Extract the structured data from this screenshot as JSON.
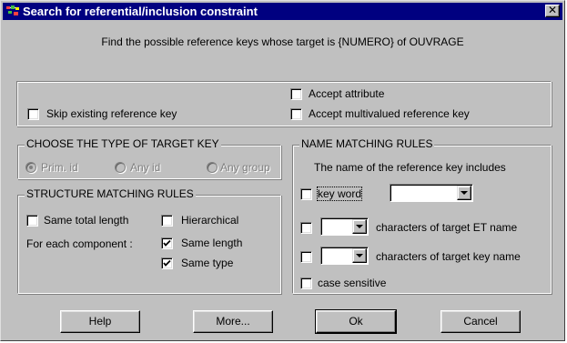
{
  "window": {
    "title": "Search for referential/inclusion constraint",
    "close_glyph": "✕"
  },
  "header": {
    "description": "Find the possible reference keys whose target is {NUMERO} of OUVRAGE"
  },
  "options": {
    "skip_existing": {
      "label": "Skip existing reference key",
      "checked": false
    },
    "accept_attribute": {
      "label": "Accept attribute",
      "checked": false
    },
    "accept_multivalued": {
      "label": "Accept multivalued reference key",
      "checked": false
    }
  },
  "target_key": {
    "title": "CHOOSE THE TYPE OF TARGET KEY",
    "options": [
      {
        "label": "Prim. id",
        "selected": true,
        "enabled": false
      },
      {
        "label": "Any id",
        "selected": false,
        "enabled": false
      },
      {
        "label": "Any group",
        "selected": false,
        "enabled": false
      }
    ]
  },
  "structure": {
    "title": "STRUCTURE MATCHING RULES",
    "same_total_length": {
      "label": "Same total length",
      "checked": false
    },
    "hierarchical": {
      "label": "Hierarchical",
      "checked": false
    },
    "for_each_component": "For each component :",
    "same_length": {
      "label": "Same length",
      "checked": true
    },
    "same_type": {
      "label": "Same type",
      "checked": true
    }
  },
  "name_matching": {
    "title": "NAME MATCHING RULES",
    "subtitle": "The name of the reference key includes",
    "key_word": {
      "label": "key word",
      "checked": false,
      "value": ""
    },
    "target_et": {
      "label": "characters of target ET name",
      "checked": false,
      "value": ""
    },
    "target_key_name": {
      "label": "characters of target key name",
      "checked": false,
      "value": ""
    },
    "case_sensitive": {
      "label": "case sensitive",
      "checked": false
    }
  },
  "buttons": {
    "help": "Help",
    "more": "More...",
    "ok": "Ok",
    "cancel": "Cancel"
  },
  "colors": {
    "titlebar": "#000080",
    "face": "#c0c0c0",
    "disabled_text": "#808080"
  }
}
